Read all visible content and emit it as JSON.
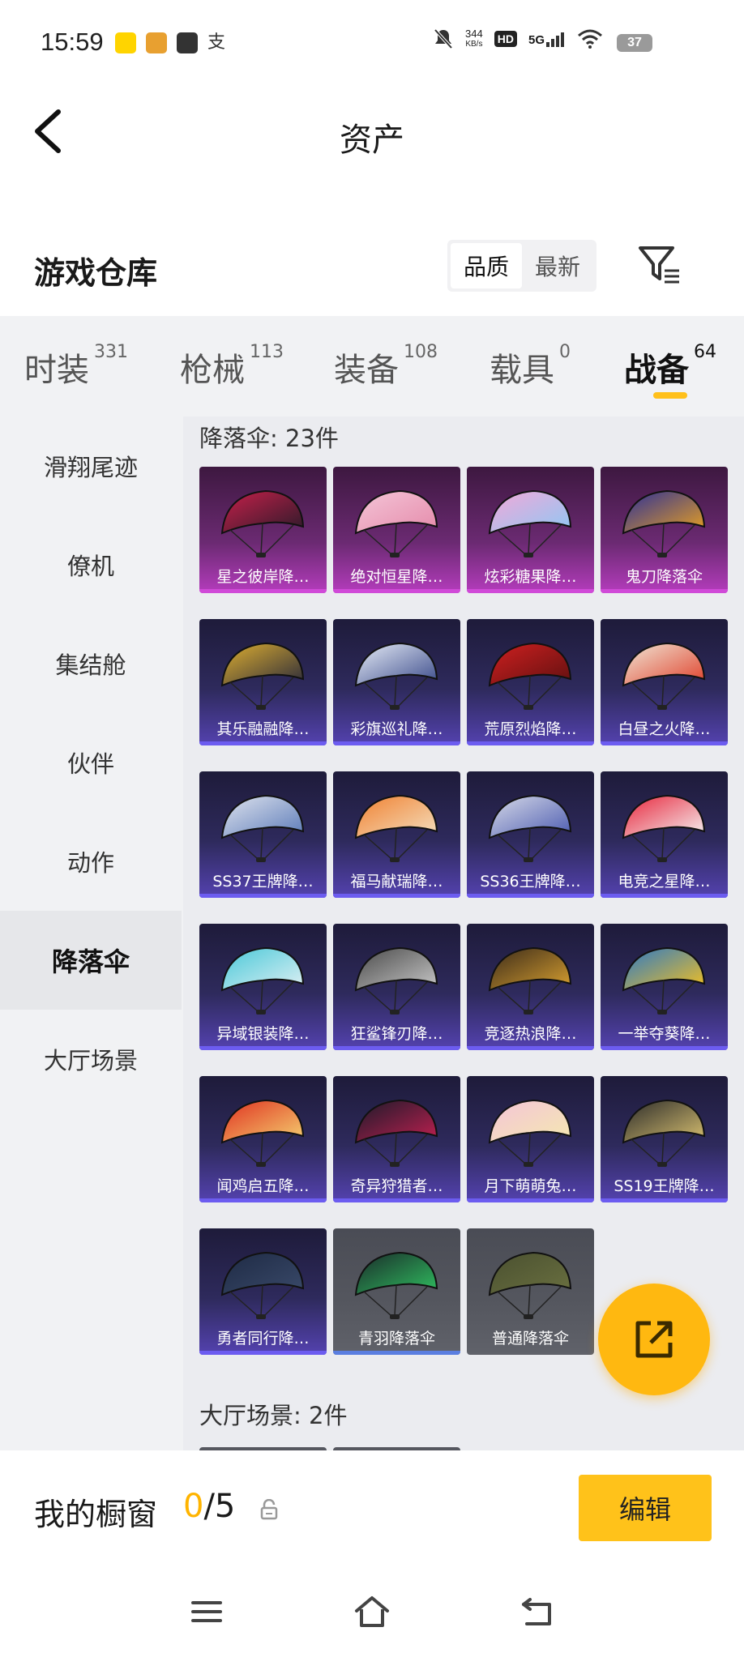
{
  "status_bar": {
    "time": "15:59",
    "app_icons": [
      "app-icon-yellow",
      "app-icon-red",
      "message-icon",
      "alipay-icon"
    ],
    "net_speed_value": "344",
    "net_speed_unit": "KB/s",
    "hd": "HD",
    "network": "5G",
    "battery": "37"
  },
  "header": {
    "title": "资产"
  },
  "warehouse": {
    "title": "游戏仓库",
    "sort_quality": "品质",
    "sort_newest": "最新",
    "active_sort": "品质"
  },
  "tabs": [
    {
      "label": "时装",
      "count": "331"
    },
    {
      "label": "枪械",
      "count": "113"
    },
    {
      "label": "装备",
      "count": "108"
    },
    {
      "label": "载具",
      "count": "0"
    },
    {
      "label": "战备",
      "count": "64",
      "active": true
    }
  ],
  "sidenav": [
    {
      "label": "滑翔尾迹"
    },
    {
      "label": "僚机"
    },
    {
      "label": "集结舱"
    },
    {
      "label": "伙伴"
    },
    {
      "label": "动作"
    },
    {
      "label": "降落伞",
      "active": true
    },
    {
      "label": "大厅场景"
    }
  ],
  "sections": {
    "parachute_label": "降落伞: 23件",
    "lobby_label": "大厅场景: 2件"
  },
  "items": [
    {
      "name": "星之彼岸降…",
      "tier": "purple-epic",
      "c1": "#c8204a",
      "c2": "#2a1a2a"
    },
    {
      "name": "绝对恒星降…",
      "tier": "purple-epic",
      "c1": "#f4c6d8",
      "c2": "#e58aaa"
    },
    {
      "name": "炫彩糖果降…",
      "tier": "purple-epic",
      "c1": "#f4a8d8",
      "c2": "#8ec8f4"
    },
    {
      "name": "鬼刀降落伞",
      "tier": "purple-epic",
      "c1": "#2a2e9a",
      "c2": "#e8a020"
    },
    {
      "name": "其乐融融降…",
      "tier": "purple",
      "c1": "#e0b030",
      "c2": "#2a2a3a"
    },
    {
      "name": "彩旗巡礼降…",
      "tier": "purple",
      "c1": "#e8eef8",
      "c2": "#3a4a8a"
    },
    {
      "name": "荒原烈焰降…",
      "tier": "purple",
      "c1": "#d02020",
      "c2": "#601010"
    },
    {
      "name": "白昼之火降…",
      "tier": "purple",
      "c1": "#f0e8d8",
      "c2": "#e0402a"
    },
    {
      "name": "SS37王牌降…",
      "tier": "purple",
      "c1": "#e0e4ee",
      "c2": "#5a7ab8"
    },
    {
      "name": "福马献瑞降…",
      "tier": "purple",
      "c1": "#f08030",
      "c2": "#f4e0c0"
    },
    {
      "name": "SS36王牌降…",
      "tier": "purple",
      "c1": "#d8dbe8",
      "c2": "#4a5ab0"
    },
    {
      "name": "电竞之星降…",
      "tier": "purple",
      "c1": "#e8243a",
      "c2": "#f4f4f4"
    },
    {
      "name": "异域银装降…",
      "tier": "purple",
      "c1": "#48c8d8",
      "c2": "#e0f0f4"
    },
    {
      "name": "狂鲨锋刃降…",
      "tier": "purple",
      "c1": "#4a4a4a",
      "c2": "#c8c8c8"
    },
    {
      "name": "竞逐热浪降…",
      "tier": "purple",
      "c1": "#3a2a1a",
      "c2": "#d8a030"
    },
    {
      "name": "一举夺葵降…",
      "tier": "purple",
      "c1": "#2a78c8",
      "c2": "#f4c020"
    },
    {
      "name": "闻鸡启五降…",
      "tier": "purple",
      "c1": "#e03020",
      "c2": "#f4d070"
    },
    {
      "name": "奇异狩猎者…",
      "tier": "purple",
      "c1": "#1a1a2a",
      "c2": "#c02050"
    },
    {
      "name": "月下萌萌兔…",
      "tier": "purple",
      "c1": "#f4c4d8",
      "c2": "#f4e8b0"
    },
    {
      "name": "SS19王牌降…",
      "tier": "purple",
      "c1": "#2a2a2a",
      "c2": "#d8c070"
    },
    {
      "name": "勇者同行降…",
      "tier": "purple",
      "c1": "#1e2a44",
      "c2": "#3a4a6a"
    },
    {
      "name": "青羽降落伞",
      "tier": "grey-blue",
      "c1": "#1a2a2a",
      "c2": "#30c060"
    },
    {
      "name": "普通降落伞",
      "tier": "grey",
      "c1": "#4a5030",
      "c2": "#6a7040"
    }
  ],
  "showcase": {
    "label": "我的橱窗",
    "current": "0",
    "total": "/5",
    "edit_label": "编辑"
  }
}
